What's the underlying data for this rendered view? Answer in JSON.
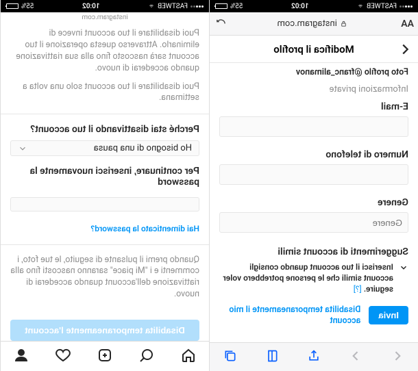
{
  "status": {
    "carrier": "FASTWEB",
    "time": "10:02",
    "battery_pct": "55%"
  },
  "right": {
    "url_host": "instagram.com",
    "aa_label": "AA",
    "header_title": "Modifica il profilo",
    "truncated_top": "Foto profilo @franc_alimanov",
    "section_private": "Informazioni private",
    "email_label": "E-mail",
    "phone_label": "Numero di telefono",
    "gender_label": "Genere",
    "gender_placeholder": "Genere",
    "suggestions_heading": "Suggerimenti di account simili",
    "suggestions_text": "Inserisci il tuo account quando consigli account simili che le persone potrebbero voler seguire.",
    "suggestions_help": "[?]",
    "submit_label": "Invia",
    "disable_link": "Disabilita temporaneamente il mio account"
  },
  "left": {
    "url_host": "instagram.com",
    "para1": "Puoi disabilitare il tuo account invece di eliminarlo. Attraverso questa operazione il tuo account sarà nascosto fino alla sua riattivazione quando accederai di nuovo.",
    "para2": "Puoi disabilitare il tuo account solo una volta a settimana.",
    "question_label": "Perché stai disattivando il tuo account?",
    "reason_value": "Ho bisogno di una pausa",
    "password_label": "Per continuare, inserisci nuovamente la password",
    "forgot_link": "Hai dimenticato la password?",
    "warning_para": "Quando premi il pulsante di seguito, le tue foto, i commenti e i \"Mi piace\" saranno nascosti fino alla riattivazione dell'account quando accederai di nuovo.",
    "disable_button": "Disabilita temporaneamente l'account"
  }
}
